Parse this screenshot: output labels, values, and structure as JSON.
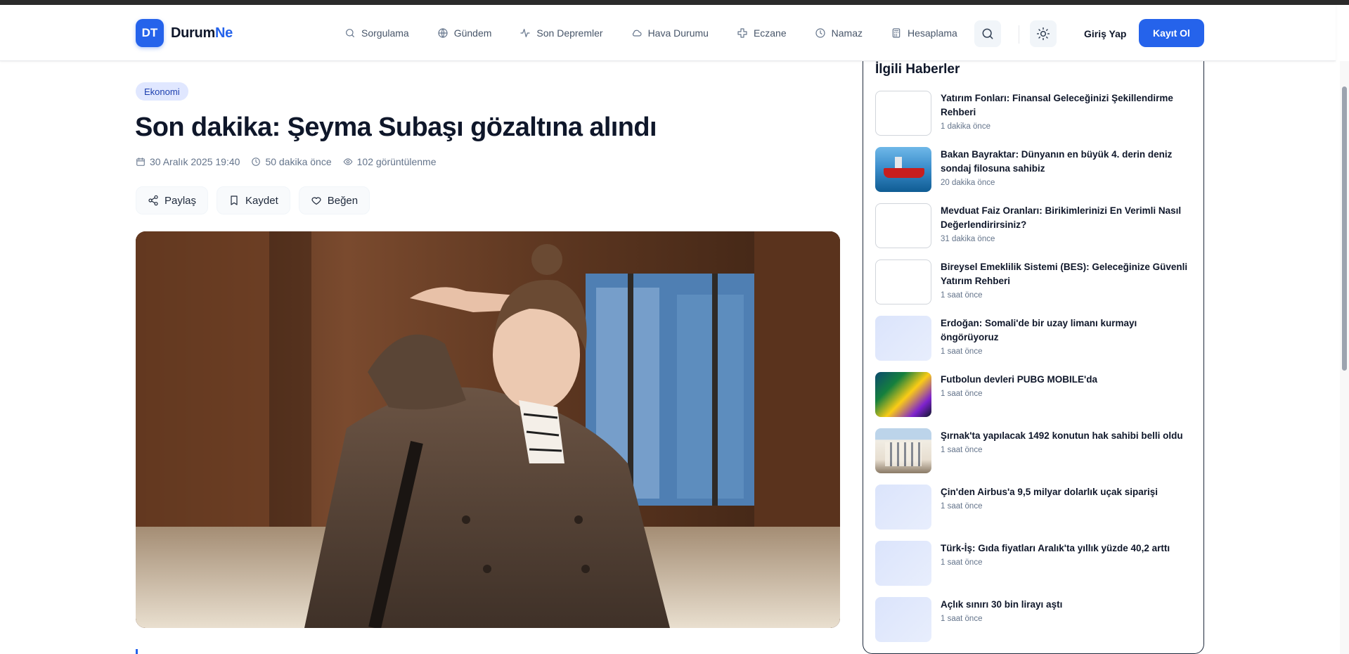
{
  "brand": {
    "mark": "DT",
    "name_part1": "Durum",
    "name_part2": "Ne",
    "accent": "#2563eb"
  },
  "nav": [
    {
      "label": "Sorgulama",
      "icon": "search-icon"
    },
    {
      "label": "Gündem",
      "icon": "globe-icon"
    },
    {
      "label": "Son Depremler",
      "icon": "activity-icon"
    },
    {
      "label": "Hava Durumu",
      "icon": "cloud-icon"
    },
    {
      "label": "Eczane",
      "icon": "cross-icon"
    },
    {
      "label": "Namaz",
      "icon": "clock-icon"
    },
    {
      "label": "Hesaplama",
      "icon": "calculator-icon"
    }
  ],
  "header_actions": {
    "login": "Giriş Yap",
    "signup": "Kayıt Ol"
  },
  "article": {
    "category": "Ekonomi",
    "title": "Son dakika: Şeyma Subaşı gözaltına alındı",
    "date": "30 Aralık 2025 19:40",
    "relative_time": "50 dakika önce",
    "views": "102 görüntülenme",
    "actions": {
      "share": "Paylaş",
      "save": "Kaydet",
      "like": "Beğen"
    }
  },
  "related": {
    "title": "İlgili Haberler",
    "items": [
      {
        "title": "Yatırım Fonları: Finansal Geleceğinizi Şekillendirme Rehberi",
        "time": "1 dakika önce"
      },
      {
        "title": "Bakan Bayraktar: Dünyanın en büyük 4. derin deniz sondaj filosuna sahibiz",
        "time": "20 dakika önce"
      },
      {
        "title": "Mevduat Faiz Oranları: Birikimlerinizi En Verimli Nasıl Değerlendirirsiniz?",
        "time": "31 dakika önce"
      },
      {
        "title": "Bireysel Emeklilik Sistemi (BES): Geleceğinize Güvenli Yatırım Rehberi",
        "time": "1 saat önce"
      },
      {
        "title": "Erdoğan: Somali'de bir uzay limanı kurmayı öngörüyoruz",
        "time": "1 saat önce"
      },
      {
        "title": "Futbolun devleri PUBG MOBILE'da",
        "time": "1 saat önce"
      },
      {
        "title": "Şırnak'ta yapılacak 1492 konutun hak sahibi belli oldu",
        "time": "1 saat önce"
      },
      {
        "title": "Çin'den Airbus'a 9,5 milyar dolarlık uçak siparişi",
        "time": "1 saat önce"
      },
      {
        "title": "Türk-İş: Gıda fiyatları Aralık'ta yıllık yüzde 40,2 arttı",
        "time": "1 saat önce"
      },
      {
        "title": "Açlık sınırı 30 bin lirayı aştı",
        "time": "1 saat önce"
      }
    ]
  }
}
